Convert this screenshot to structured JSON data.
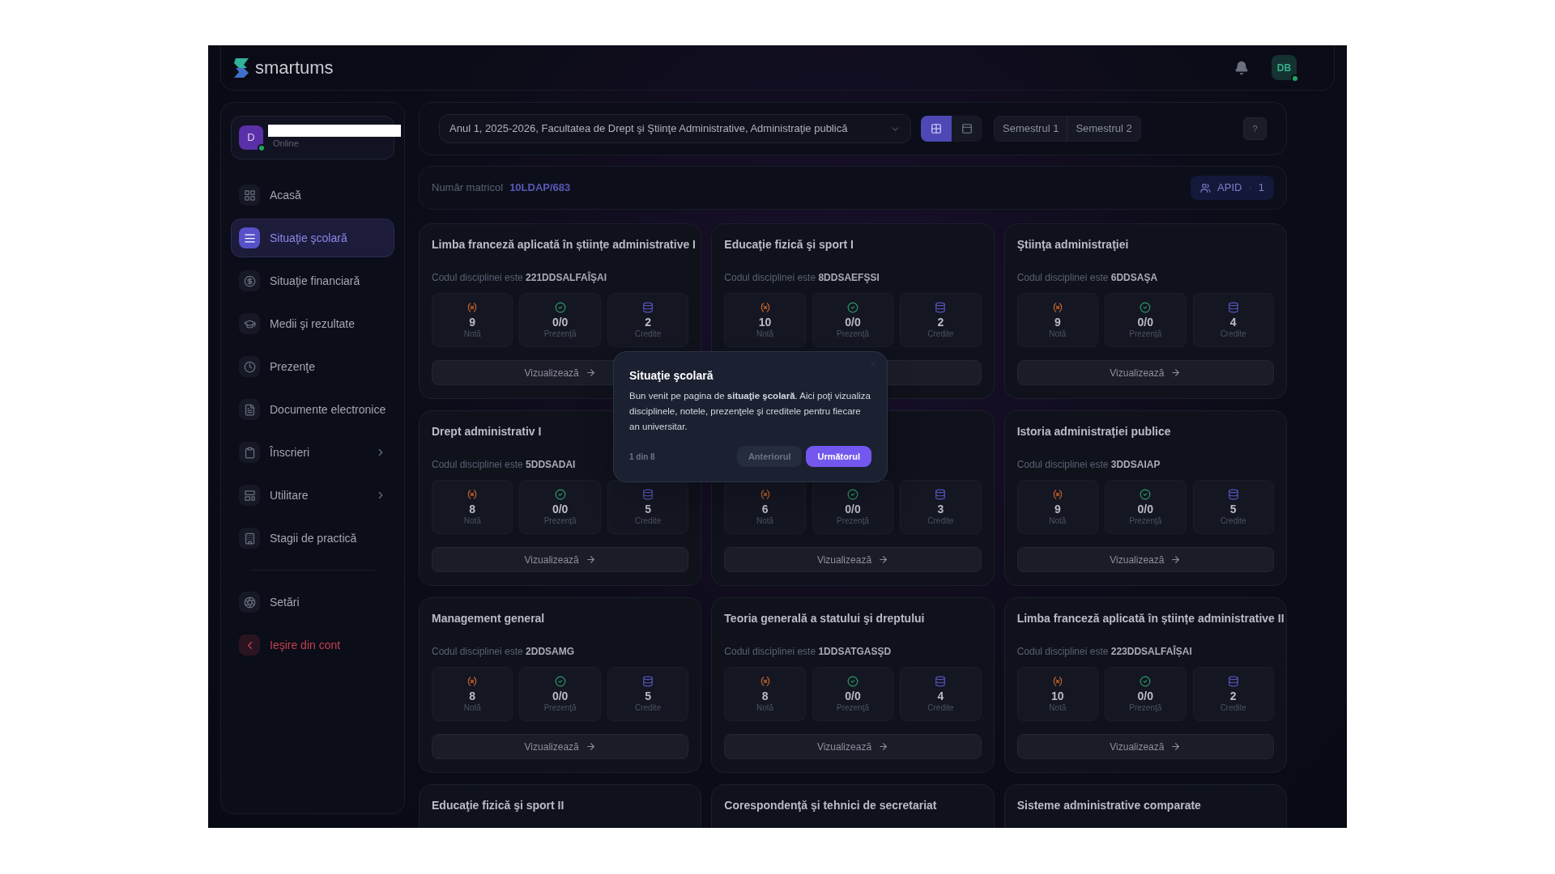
{
  "header": {
    "brand": "smartums",
    "avatar": "DB",
    "online": true
  },
  "user": {
    "initial": "D",
    "status": "Online",
    "online": true
  },
  "sidebar": {
    "items": [
      {
        "label": "Acasă",
        "selected": false,
        "has_submenu": false,
        "kind": "nav"
      },
      {
        "label": "Situaţie şcolară",
        "selected": true,
        "has_submenu": false,
        "kind": "nav"
      },
      {
        "label": "Situaţie financiară",
        "selected": false,
        "has_submenu": false,
        "kind": "nav"
      },
      {
        "label": "Medii şi rezultate",
        "selected": false,
        "has_submenu": false,
        "kind": "nav"
      },
      {
        "label": "Prezenţe",
        "selected": false,
        "has_submenu": false,
        "kind": "nav"
      },
      {
        "label": "Documente electronice",
        "selected": false,
        "has_submenu": false,
        "kind": "nav"
      },
      {
        "label": "Înscrieri",
        "selected": false,
        "has_submenu": true,
        "kind": "nav"
      },
      {
        "label": "Utilitare",
        "selected": false,
        "has_submenu": true,
        "kind": "nav"
      },
      {
        "label": "Stagii de practică",
        "selected": false,
        "has_submenu": false,
        "kind": "nav"
      }
    ],
    "bottom_items": [
      {
        "label": "Setări",
        "selected": false,
        "has_submenu": false,
        "kind": "nav"
      },
      {
        "label": "Ieşire din cont",
        "selected": false,
        "has_submenu": false,
        "kind": "logout"
      }
    ]
  },
  "filters": {
    "program": "Anul 1, 2025-2026, Facultatea de Drept şi Ştiinţe Administrative, Administraţie publică",
    "views": [
      {
        "kind": "grid",
        "selected": true
      },
      {
        "kind": "cards",
        "selected": false
      }
    ],
    "semesters": [
      {
        "label": "Semestrul 1",
        "selected": false
      },
      {
        "label": "Semestrul 2",
        "selected": false
      }
    ],
    "help": "?"
  },
  "matricol": {
    "label": "Număr matricol",
    "value": "10LDAP/683",
    "group": "APID",
    "separator": "·",
    "count": "1"
  },
  "courses": [
    {
      "title": "Limba franceză aplicată în științe administrative I",
      "code_label": "Codul disciplinei este",
      "code": "221DDSALFAÎŞAI",
      "stats": [
        {
          "kind": "grade",
          "value": "9",
          "label": "Notă"
        },
        {
          "kind": "attendance",
          "value": "0/0",
          "label": "Prezenţă"
        },
        {
          "kind": "credits",
          "value": "2",
          "label": "Credite"
        }
      ],
      "button": "Vizualizează"
    },
    {
      "title": "Educaţie fizică şi sport I",
      "code_label": "Codul disciplinei este",
      "code": "8DDSAEFŞSI",
      "stats": [
        {
          "kind": "grade",
          "value": "10",
          "label": "Notă"
        },
        {
          "kind": "attendance",
          "value": "0/0",
          "label": "Prezenţă"
        },
        {
          "kind": "credits",
          "value": "2",
          "label": "Credite"
        }
      ]
    },
    {
      "title": "Ştiinţa administraţiei",
      "code_label": "Codul disciplinei este",
      "code": "6DDSAŞA",
      "stats": [
        {
          "kind": "grade",
          "value": "9",
          "label": "Notă"
        },
        {
          "kind": "attendance",
          "value": "0/0",
          "label": "Prezenţă"
        },
        {
          "kind": "credits",
          "value": "4",
          "label": "Credite"
        }
      ],
      "button": "Vizualizează"
    },
    {
      "title": "Drept administrativ I",
      "code_label": "Codul disciplinei este",
      "code": "5DDSADAI",
      "stats": [
        {
          "kind": "grade",
          "value": "8",
          "label": "Notă"
        },
        {
          "kind": "attendance",
          "value": "0/0",
          "label": "Prezenţă"
        },
        {
          "kind": "credits",
          "value": "5",
          "label": "Credite"
        }
      ],
      "button": "Vizualizează"
    },
    {
      "stats": [
        {
          "kind": "grade",
          "value": "6",
          "label": "Notă"
        },
        {
          "kind": "attendance",
          "value": "0/0",
          "label": "Prezenţă"
        },
        {
          "kind": "credits",
          "value": "3",
          "label": "Credite"
        }
      ],
      "button": "Vizualizează"
    },
    {
      "title": "Istoria administraţiei publice",
      "code_label": "Codul disciplinei este",
      "code": "3DDSAIAP",
      "stats": [
        {
          "kind": "grade",
          "value": "9",
          "label": "Notă"
        },
        {
          "kind": "attendance",
          "value": "0/0",
          "label": "Prezenţă"
        },
        {
          "kind": "credits",
          "value": "5",
          "label": "Credite"
        }
      ],
      "button": "Vizualizează"
    },
    {
      "title": "Management general",
      "code_label": "Codul disciplinei este",
      "code": "2DDSAMG",
      "stats": [
        {
          "kind": "grade",
          "value": "8",
          "label": "Notă"
        },
        {
          "kind": "attendance",
          "value": "0/0",
          "label": "Prezenţă"
        },
        {
          "kind": "credits",
          "value": "5",
          "label": "Credite"
        }
      ],
      "button": "Vizualizează"
    },
    {
      "title": "Teoria generală a statului şi dreptului",
      "code_label": "Codul disciplinei este",
      "code": "1DDSATGASŞD",
      "stats": [
        {
          "kind": "grade",
          "value": "8",
          "label": "Notă"
        },
        {
          "kind": "attendance",
          "value": "0/0",
          "label": "Prezenţă"
        },
        {
          "kind": "credits",
          "value": "4",
          "label": "Credite"
        }
      ],
      "button": "Vizualizează"
    },
    {
      "title": "Limba franceză aplicată în științe administrative II",
      "code_label": "Codul disciplinei este",
      "code": "223DDSALFAÎȘAI",
      "stats": [
        {
          "kind": "grade",
          "value": "10",
          "label": "Notă"
        },
        {
          "kind": "attendance",
          "value": "0/0",
          "label": "Prezenţă"
        },
        {
          "kind": "credits",
          "value": "2",
          "label": "Credite"
        }
      ],
      "button": "Vizualizează"
    },
    {
      "title": "Educaţie fizică şi sport II"
    },
    {
      "title": "Corespondenţă şi tehnici de secretariat"
    },
    {
      "title": "Sisteme administrative comparate"
    }
  ],
  "tour": {
    "title": "Situaţie şcolară",
    "body": "Bun venit pe pagina de **situaţie şcolară**. Aici poţi vizualiza disciplinele, notele, prezenţele şi creditele pentru fiecare an universitar.",
    "step": "1 din 8",
    "buttons": [
      {
        "label": "Anteriorul",
        "kind": "secondary"
      },
      {
        "label": "Următorul",
        "kind": "primary"
      }
    ]
  }
}
